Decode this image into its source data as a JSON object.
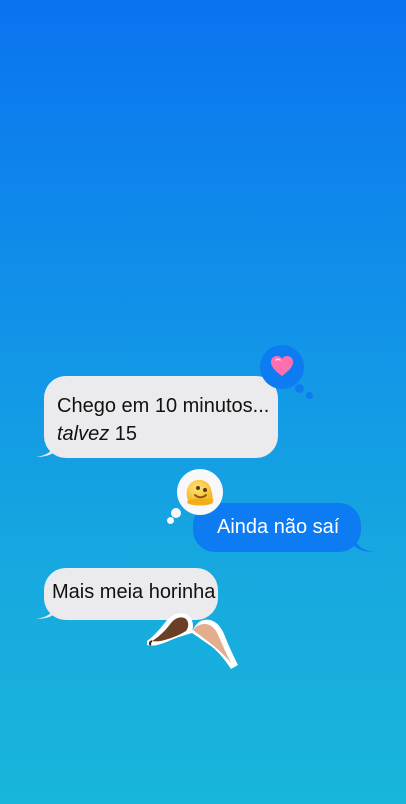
{
  "messages": {
    "incoming_1": {
      "text_line1": "Chego em 10 minutos...",
      "text_line2_italic": "talvez",
      "text_line2_rest": " 15",
      "reaction_icon": "heart"
    },
    "outgoing_1": {
      "text": "Ainda não saí",
      "reaction_icon": "melting-face"
    },
    "incoming_2": {
      "text": "Mais meia horinha",
      "sticker_icon": "heart-hands"
    }
  },
  "colors": {
    "background_top": "#0a73f0",
    "background_bottom": "#18b6db",
    "incoming_bubble": "#ebebed",
    "outgoing_bubble": "#0d7cf2",
    "reaction_heart": "#ff6fae"
  }
}
